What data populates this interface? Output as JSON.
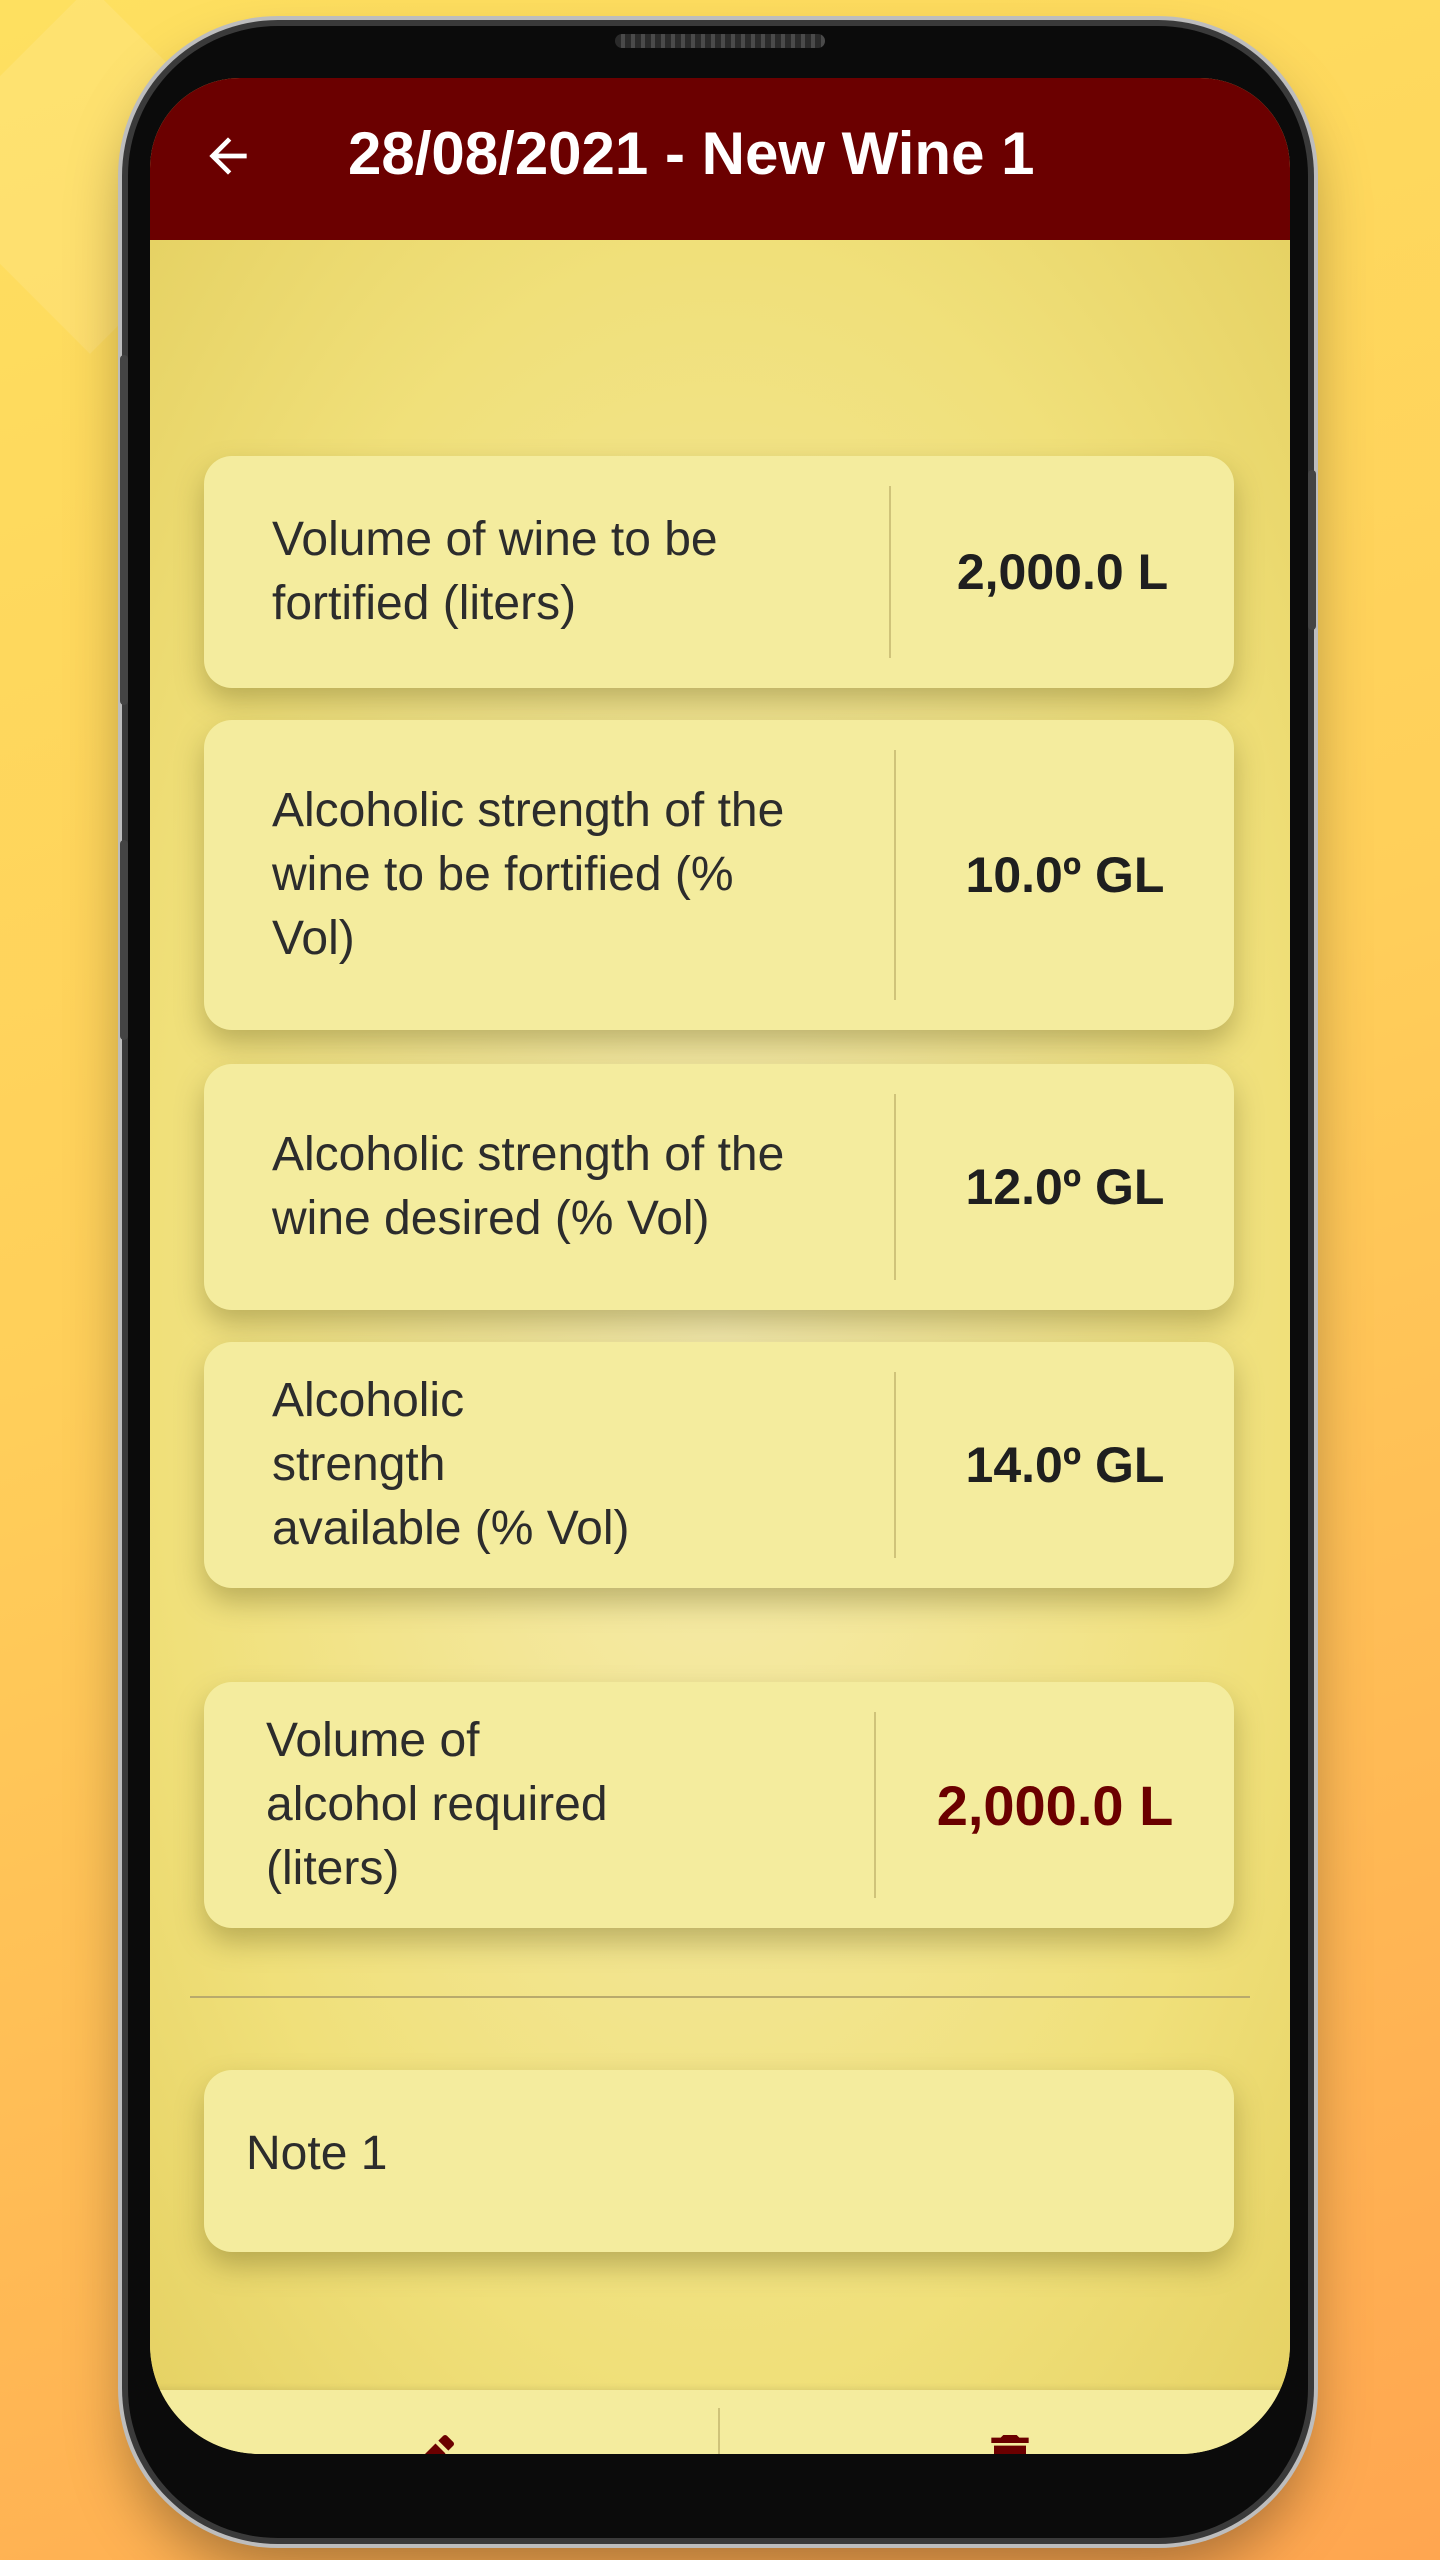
{
  "app_bar": {
    "title": "28/08/2021 - New Wine 1",
    "back_icon": "arrow-left-icon"
  },
  "cards": [
    {
      "label": "Volume of wine to be fortified (liters)",
      "value": "2,000.0 L"
    },
    {
      "label": "Alcoholic strength of the wine to be fortified (% Vol)",
      "value": "10.0º GL"
    },
    {
      "label": "Alcoholic strength of the wine desired (% Vol)",
      "value": "12.0º GL"
    },
    {
      "label": "Alcoholic strength available (% Vol)",
      "value": "14.0º GL"
    }
  ],
  "result": {
    "label": "Volume of alcohol required (liters)",
    "value": "2,000.0 L"
  },
  "note": {
    "text": "Note 1"
  },
  "bottom_bar": {
    "edit_icon": "pencil-icon",
    "delete_icon": "trash-icon"
  },
  "colors": {
    "primary": "#6b0000",
    "card_background": "#f4ec9e",
    "screen_background": "#efe07f",
    "page_background_top": "#fee060",
    "page_background_bottom": "#ffa650"
  }
}
